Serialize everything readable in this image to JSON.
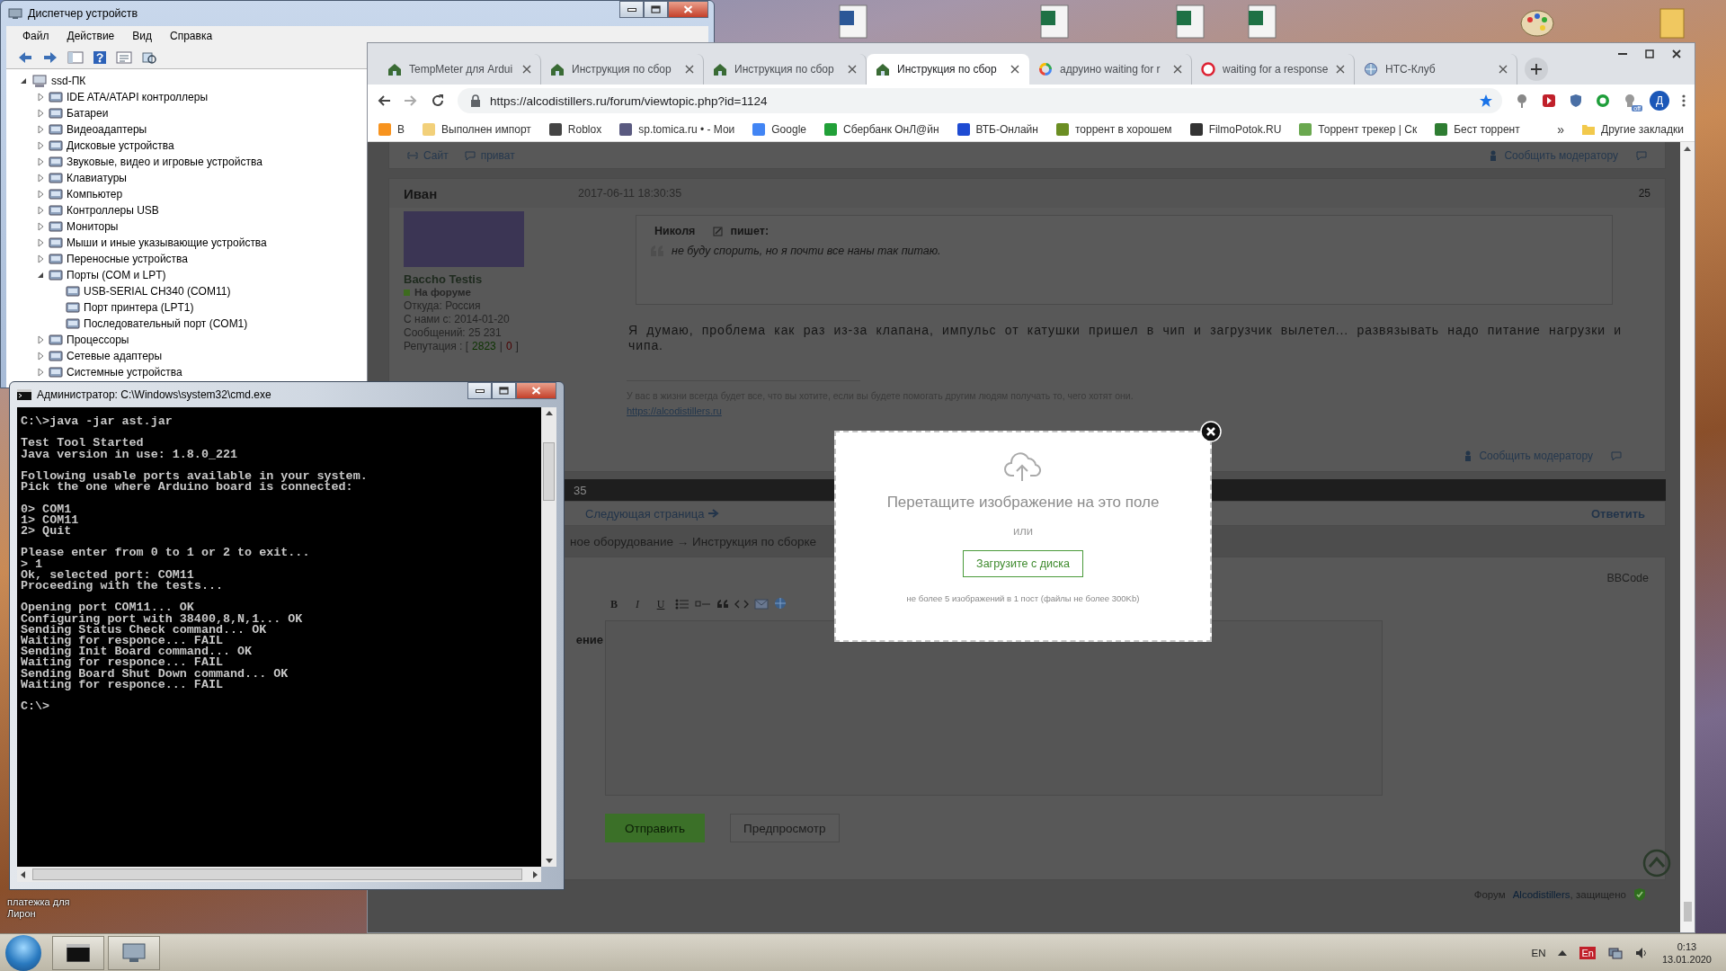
{
  "desktop": {
    "icon_label": "платежка для Лирон"
  },
  "device_manager": {
    "title": "Диспетчер устройств",
    "menu": [
      "Файл",
      "Действие",
      "Вид",
      "Справка"
    ],
    "tree": {
      "label": "ssd-ПК",
      "expanded": true,
      "children": [
        {
          "label": "IDE ATA/ATAPI контроллеры",
          "expanded": false
        },
        {
          "label": "Батареи",
          "expanded": false
        },
        {
          "label": "Видеоадаптеры",
          "expanded": false
        },
        {
          "label": "Дисковые устройства",
          "expanded": false
        },
        {
          "label": "Звуковые, видео и игровые устройства",
          "expanded": false
        },
        {
          "label": "Клавиатуры",
          "expanded": false
        },
        {
          "label": "Компьютер",
          "expanded": false
        },
        {
          "label": "Контроллеры USB",
          "expanded": false
        },
        {
          "label": "Мониторы",
          "expanded": false
        },
        {
          "label": "Мыши и иные указывающие устройства",
          "expanded": false
        },
        {
          "label": "Переносные устройства",
          "expanded": false
        },
        {
          "label": "Порты (COM и LPT)",
          "expanded": true,
          "children": [
            {
              "label": "USB-SERIAL CH340 (COM11)"
            },
            {
              "label": "Порт принтера (LPT1)"
            },
            {
              "label": "Последовательный порт (COM1)"
            }
          ]
        },
        {
          "label": "Процессоры",
          "expanded": false
        },
        {
          "label": "Сетевые адаптеры",
          "expanded": false
        },
        {
          "label": "Системные устройства",
          "expanded": false
        }
      ]
    }
  },
  "browser": {
    "tabs": [
      {
        "title": "TempMeter для Ardui",
        "kind": "forum",
        "selected": false
      },
      {
        "title": "Инструкция по сбор",
        "kind": "forum",
        "selected": false
      },
      {
        "title": "Инструкция по сбор",
        "kind": "forum",
        "selected": false
      },
      {
        "title": "Инструкция по сбор",
        "kind": "forum",
        "selected": true
      },
      {
        "title": "адруино waiting for r",
        "kind": "google",
        "selected": false
      },
      {
        "title": "waiting for a response",
        "kind": "web",
        "selected": false
      },
      {
        "title": "НТС-Клуб",
        "kind": "club",
        "selected": false
      }
    ],
    "url": "https://alcodistillers.ru/forum/viewtopic.php?id=1124",
    "extension_badge": "off",
    "profile_initial": "Д",
    "bookmarks": [
      {
        "label": "В",
        "color": "#f7931e"
      },
      {
        "label": "Выполнен импорт",
        "color": "#f2d07a"
      },
      {
        "label": "Roblox",
        "color": "#444444"
      },
      {
        "label": "sp.tomica.ru • - Мои",
        "color": "#5a5a80"
      },
      {
        "label": "Google",
        "color": "#4285f4"
      },
      {
        "label": "Сбербанк ОнЛ@йн",
        "color": "#21a038"
      },
      {
        "label": "ВТБ-Онлайн",
        "color": "#1e4bd2"
      },
      {
        "label": "торрент в хорошем",
        "color": "#6b8e23"
      },
      {
        "label": "FilmoPotok.RU",
        "color": "#333333"
      },
      {
        "label": "Торрент трекер | Ск",
        "color": "#6aa84f"
      },
      {
        "label": "Бест торрент",
        "color": "#2e7d32"
      }
    ],
    "more_bookmarks": "»",
    "other_bookmarks": "Другие закладки"
  },
  "forum": {
    "site_link": "Сайт",
    "private_link": "приват",
    "report_link": "Сообщить модератору",
    "post": {
      "author": "Иван",
      "date": "2017-06-11 18:30:35",
      "number": "25",
      "user_title": "Baccho Testis",
      "status": "На форуме",
      "info": [
        "Откуда: Россия",
        "С нами с: 2014-01-20",
        "Сообщений: 25 231"
      ],
      "reputation": {
        "label": "Репутация : [",
        "plus": "2823",
        "separator": "|",
        "minus": "0",
        "close": "]"
      },
      "quote": {
        "author": "Николя",
        "verb": "пишет:",
        "text": "не буду спорить, но я почти все наны так питаю."
      },
      "text": "Я думаю, проблема как раз из-за клапана, импульс от катушки пришел в чип и загрузчик вылетел... развязывать надо питание нагрузки и чипа.",
      "signature": "У вас в жизни всегда будет все, что вы хотите, если вы будете помогать другим людям получать то, чего хотят они.",
      "signature_link": "https://alcodistillers.ru",
      "report_link": "Сообщить модератору"
    },
    "pagination_tail": "35",
    "next_page": "Следующая страница",
    "reply": "Ответить",
    "breadcrumb": "ное оборудование → Инструкция по сборке",
    "editor": {
      "mode_tab": "BBCode",
      "format_buttons": [
        "B",
        "I",
        "U"
      ],
      "field_label": "ение",
      "submit": "Отправить",
      "preview": "Предпросмотр"
    },
    "footer": {
      "label": "Форум",
      "link": "Alcodistillers",
      "suffix": ", защищено"
    }
  },
  "upload_dialog": {
    "title": "Перетащите изображение на это поле",
    "or": "или",
    "button": "Загрузите с диска",
    "note": "не более 5 изображений в 1 пост (файлы не более 300Kb)"
  },
  "cmd": {
    "title": "Администратор: C:\\Windows\\system32\\cmd.exe",
    "blocks": [
      [
        "C:\\>java -jar ast.jar"
      ],
      [
        "Test Tool Started",
        "Java version in use: 1.8.0_221"
      ],
      [
        "Following usable ports available in your system.",
        "Pick the one where Arduino board is connected:"
      ],
      [
        "0> COM1",
        "1> COM11",
        "2> Quit"
      ],
      [
        "Please enter from 0 to 1 or 2 to exit...",
        "> 1",
        "Ok, selected port: COM11",
        "Proceeding with the tests..."
      ],
      [
        "Opening port COM11... OK",
        "Configuring port with 38400,8,N,1... OK",
        "Sending Status Check command... OK",
        "Waiting for responce... FAIL",
        "Sending Init Board command... OK",
        "Waiting for responce... FAIL",
        "Sending Board Shut Down command... OK",
        "Waiting for responce... FAIL"
      ],
      [
        "C:\\>"
      ]
    ]
  },
  "taskbar": {
    "language": "EN",
    "layout": "En",
    "time": "0:13",
    "date": "13.01.2020"
  }
}
